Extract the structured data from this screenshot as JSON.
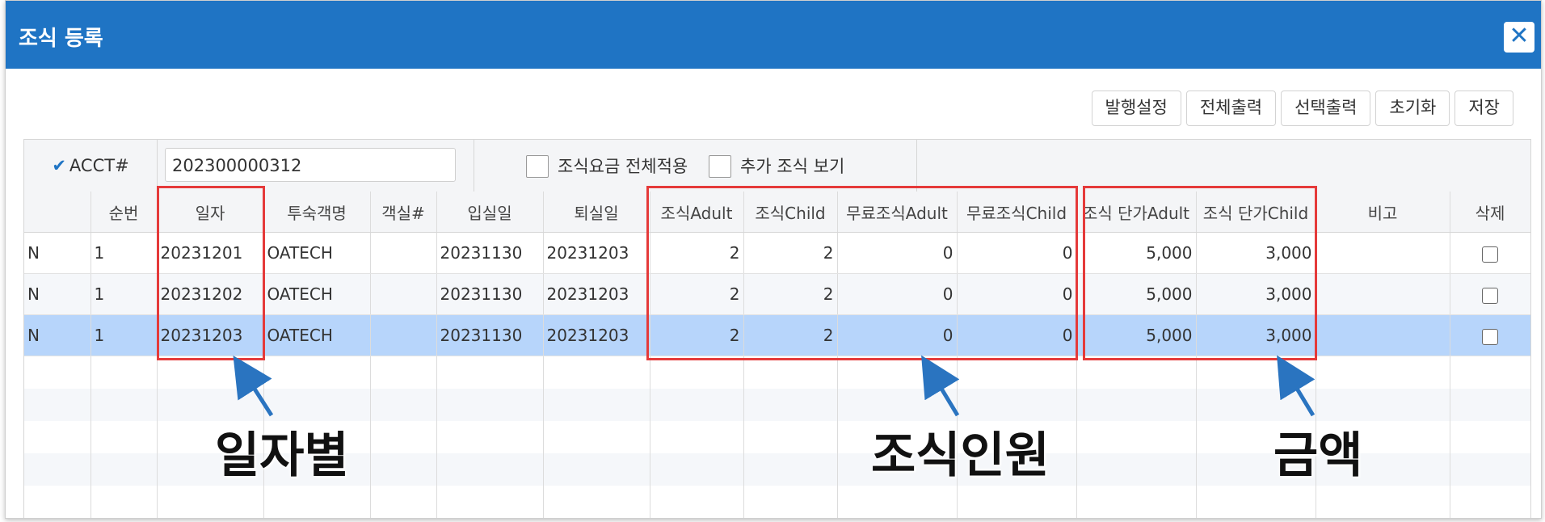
{
  "window": {
    "title": "조식 등록",
    "close_icon": "close-icon"
  },
  "toolbar": {
    "buttons": [
      "발행설정",
      "전체출력",
      "선택출력",
      "초기화",
      "저장"
    ]
  },
  "filter": {
    "acct_label": "ACCT#",
    "acct_value": "202300000312",
    "option_apply_all": "조식요금 전체적용",
    "option_show_extra": "추가 조식 보기"
  },
  "table": {
    "columns": [
      "",
      "순번",
      "일자",
      "투숙객명",
      "객실#",
      "입실일",
      "퇴실일",
      "조식Adult",
      "조식Child",
      "무료조식Adult",
      "무료조식Child",
      "조식 단가Adult",
      "조식 단가Child",
      "비고",
      "삭제"
    ],
    "rows": [
      [
        "N",
        "1",
        "20231201",
        "OATECH",
        "",
        "20231130",
        "20231203",
        "2",
        "2",
        "0",
        "0",
        "5,000",
        "3,000",
        ""
      ],
      [
        "N",
        "1",
        "20231202",
        "OATECH",
        "",
        "20231130",
        "20231203",
        "2",
        "2",
        "0",
        "0",
        "5,000",
        "3,000",
        ""
      ],
      [
        "N",
        "1",
        "20231203",
        "OATECH",
        "",
        "20231130",
        "20231203",
        "2",
        "2",
        "0",
        "0",
        "5,000",
        "3,000",
        ""
      ]
    ],
    "selected_row_index": 2
  },
  "annotations": {
    "by_date": "일자별",
    "headcount": "조식인원",
    "amount": "금액"
  },
  "colors": {
    "titlebar": "#1f74c4",
    "selected_row": "#b7d5fb",
    "highlight_box": "#e53a3a",
    "arrow": "#2a74c0"
  }
}
